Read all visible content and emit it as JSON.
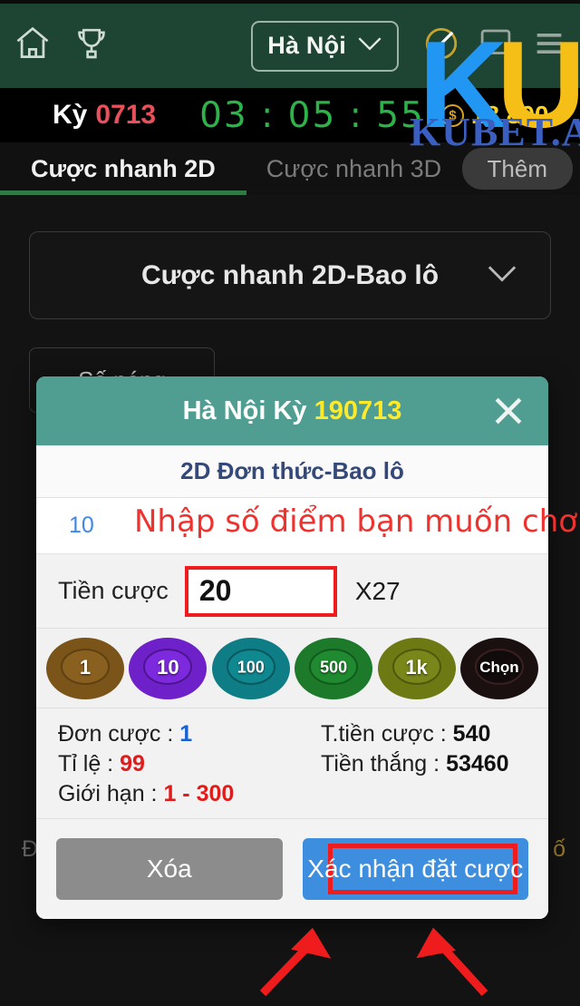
{
  "topbar": {
    "home_icon": "home-icon",
    "trophy_icon": "trophy-icon",
    "city_label": "Hà Nội",
    "caret_icon": "chevron-down-icon",
    "sound_off_icon": "sound-muted-icon",
    "chat_icon": "chat-square-icon",
    "menu_icon": "hamburger-menu-icon"
  },
  "watermark": {
    "logo_k": "K",
    "logo_u": "U",
    "site_text": "KUBET.AZ",
    "logo_k_color": "#2196f3",
    "logo_u_color": "#f5bf17",
    "site_text_color": "#3b5fc0"
  },
  "timer": {
    "ky_label": "Kỳ",
    "ky_value": "0713",
    "countdown": "03 : 05 : 55",
    "coin_icon": "coin-dollar-icon",
    "balance": "18 800",
    "countdown_color": "#2eb24a",
    "ky_value_color": "#e8505b",
    "balance_color": "#ffd21e"
  },
  "tabs": {
    "items": [
      {
        "label": "Cược nhanh 2D",
        "active": true
      },
      {
        "label": "Cược nhanh 3D",
        "active": false
      }
    ],
    "more_label": "Thêm",
    "active_underline_color": "#2f7a47"
  },
  "page": {
    "mode_label": "Cược nhanh 2D-Bao lô",
    "mode_caret_icon": "chevron-down-icon",
    "hot_label": "Số nóng",
    "faint_left": "Đ",
    "faint_right": "ố"
  },
  "modal": {
    "title_prefix": "Hà Nội Kỳ ",
    "title_highlight": "190713",
    "close_icon": "close-x-icon",
    "sub_title": "2D Đơn thức-Bao lô",
    "pick_number": "10",
    "annotation": "Nhập số điểm bạn muốn chơi",
    "annotation_color": "#f0322e",
    "stake_label": "Tiền cược",
    "stake_value": "20",
    "stake_multiplier": "X27",
    "header_color": "#4f9e91",
    "chips": [
      {
        "label": "1",
        "color": "#7a5418",
        "name": "chip-1"
      },
      {
        "label": "10",
        "color": "#6f21c9",
        "name": "chip-10"
      },
      {
        "label": "100",
        "color": "#0e7d85",
        "name": "chip-100"
      },
      {
        "label": "500",
        "color": "#1c7a2a",
        "name": "chip-500"
      },
      {
        "label": "1k",
        "color": "#6d7a13",
        "name": "chip-1k"
      },
      {
        "label": "Chọn",
        "color": "#1a1010",
        "name": "chip-choose"
      }
    ],
    "info": {
      "unit_bet_label": "Đơn cược : ",
      "unit_bet_value": "1",
      "total_bet_label": "T.tiền cược : ",
      "total_bet_value": "540",
      "rate_label": "Tỉ lệ : ",
      "rate_value": "99",
      "win_label": "Tiền thắng : ",
      "win_value": "53460",
      "limit_label": "Giới hạn : ",
      "limit_value": "1 - 300"
    },
    "clear_button": "Xóa",
    "confirm_button": "Xác nhận đặt cược",
    "confirm_button_color": "#3d8ede",
    "clear_button_color": "#8c8c8c",
    "highlight_color": "#ee1c1c"
  }
}
